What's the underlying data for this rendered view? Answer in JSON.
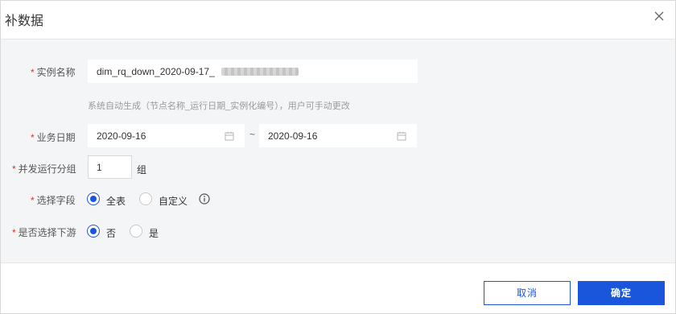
{
  "dialog": {
    "title": "补数据",
    "close_icon": "close-icon"
  },
  "form": {
    "instance_name": {
      "label": "实例名称",
      "required": "*",
      "value": "dim_rq_down_2020-09-17_",
      "hint": "系统自动生成（节点名称_运行日期_实例化编号），用户可手动更改"
    },
    "business_date": {
      "label": "业务日期",
      "required": "*",
      "start": "2020-09-16",
      "separator": "~",
      "end": "2020-09-16",
      "icon": "calendar-icon"
    },
    "parallel_groups": {
      "label": "并发运行分组",
      "required": "*",
      "value": "1",
      "unit": "组"
    },
    "select_fields": {
      "label": "选择字段",
      "required": "*",
      "options": [
        "全表",
        "自定义"
      ],
      "selected": "全表",
      "info_icon": "info-icon"
    },
    "select_downstream": {
      "label": "是否选择下游",
      "required": "*",
      "options": [
        "否",
        "是"
      ],
      "selected": "否"
    }
  },
  "footer": {
    "cancel_label": "取消",
    "ok_label": "确定"
  },
  "colors": {
    "primary": "#1a56db",
    "required": "#d9312c",
    "body_bg": "#f4f5f7"
  }
}
